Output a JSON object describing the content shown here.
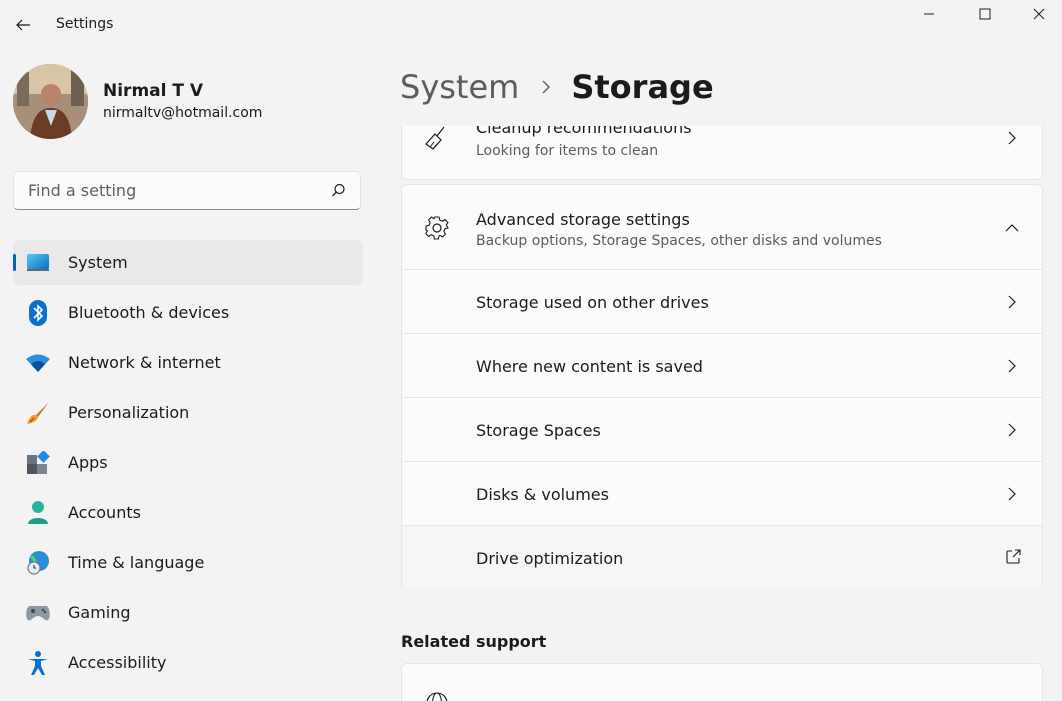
{
  "window": {
    "title": "Settings"
  },
  "user": {
    "name": "Nirmal T V",
    "email": "nirmaltv@hotmail.com"
  },
  "search": {
    "placeholder": "Find a setting",
    "value": ""
  },
  "nav": {
    "items": [
      {
        "label": "System",
        "icon": "system-icon",
        "active": true
      },
      {
        "label": "Bluetooth & devices",
        "icon": "bluetooth-icon"
      },
      {
        "label": "Network & internet",
        "icon": "wifi-icon"
      },
      {
        "label": "Personalization",
        "icon": "brush-icon"
      },
      {
        "label": "Apps",
        "icon": "apps-icon"
      },
      {
        "label": "Accounts",
        "icon": "person-icon"
      },
      {
        "label": "Time & language",
        "icon": "globe-clock-icon"
      },
      {
        "label": "Gaming",
        "icon": "gamepad-icon"
      },
      {
        "label": "Accessibility",
        "icon": "accessibility-icon"
      }
    ]
  },
  "breadcrumb": {
    "parent": "System",
    "current": "Storage"
  },
  "cleanup": {
    "title": "Cleanup recommendations",
    "subtitle": "Looking for items to clean"
  },
  "advanced": {
    "title": "Advanced storage settings",
    "subtitle": "Backup options, Storage Spaces, other disks and volumes",
    "expanded": true,
    "items": [
      {
        "label": "Storage used on other drives",
        "action": "chevron-right-icon"
      },
      {
        "label": "Where new content is saved",
        "action": "chevron-right-icon"
      },
      {
        "label": "Storage Spaces",
        "action": "chevron-right-icon"
      },
      {
        "label": "Disks & volumes",
        "action": "chevron-right-icon"
      },
      {
        "label": "Drive optimization",
        "action": "external-link-icon"
      }
    ]
  },
  "related_support": {
    "heading": "Related support"
  },
  "colors": {
    "accent": "#0067c0",
    "background": "#f3f3f3",
    "card": "#fbfbfb"
  }
}
